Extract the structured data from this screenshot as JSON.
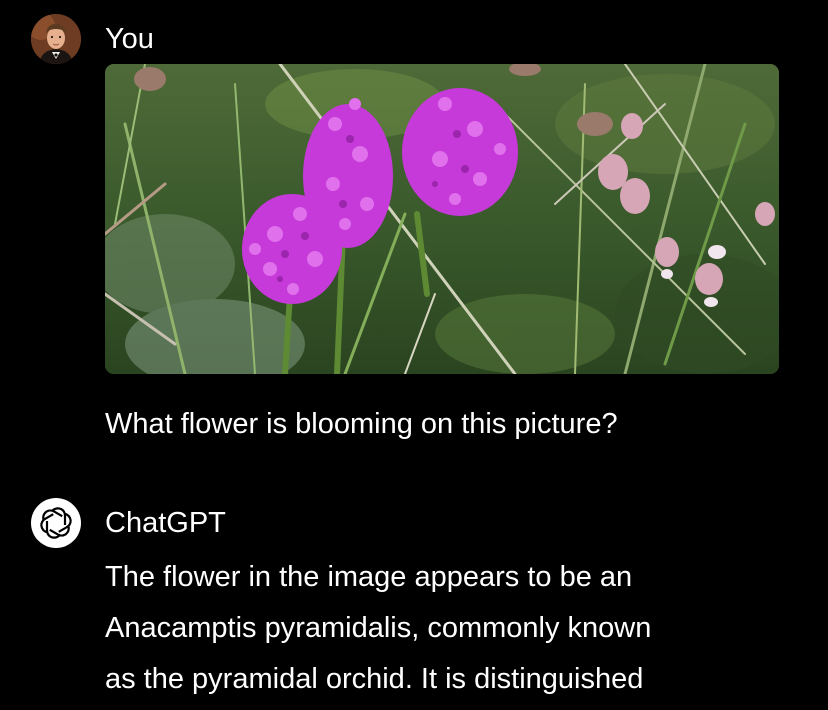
{
  "user": {
    "name": "You",
    "avatar_icon": "user-avatar-photo",
    "message": "What flower is blooming on this picture?"
  },
  "assistant": {
    "name": "ChatGPT",
    "logo_icon": "openai-logo-icon",
    "response_lines": [
      "The flower in the image appears to be an",
      "Anacamptis pyramidalis, commonly known",
      "as the pyramidal orchid. It is distinguished"
    ]
  },
  "colors": {
    "background": "#000000",
    "text": "#ffffff",
    "flower": "#c53ad8",
    "foliage": "#3d5a2a"
  }
}
